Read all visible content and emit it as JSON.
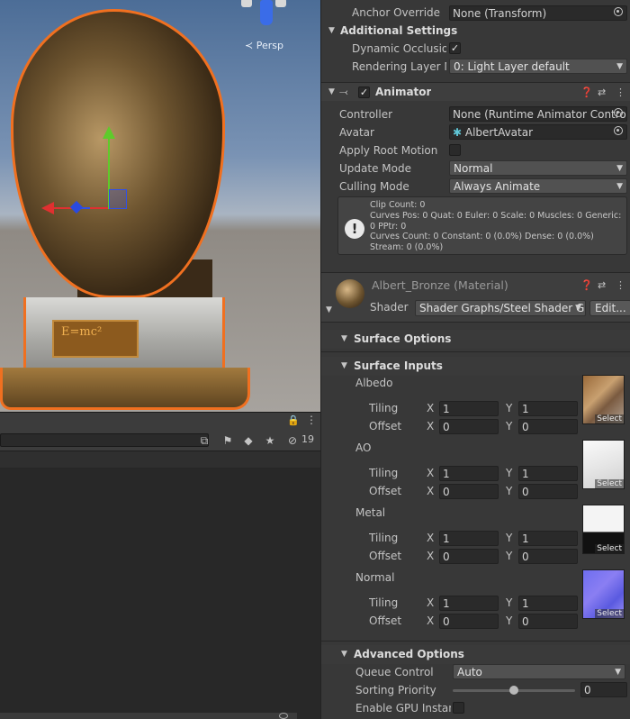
{
  "scene": {
    "camera_label": "Persp",
    "plaque_text": "E=mc²"
  },
  "hierarchy": {
    "visible_count": "19"
  },
  "inspector": {
    "renderer_tail": {
      "anchor_override_label": "Anchor Override",
      "anchor_override_value": "None (Transform)",
      "additional_settings_label": "Additional Settings",
      "dynamic_occlusion_label": "Dynamic Occlusion",
      "dynamic_occlusion_checked": true,
      "rendering_layer_label": "Rendering Layer M",
      "rendering_layer_value": "0: Light Layer default"
    },
    "animator": {
      "title": "Animator",
      "enabled": true,
      "controller_label": "Controller",
      "controller_value": "None (Runtime Animator Contro",
      "avatar_label": "Avatar",
      "avatar_value": "AlbertAvatar",
      "apply_root_motion_label": "Apply Root Motion",
      "apply_root_motion_checked": false,
      "update_mode_label": "Update Mode",
      "update_mode_value": "Normal",
      "culling_mode_label": "Culling Mode",
      "culling_mode_value": "Always Animate",
      "info_lines": [
        "Clip Count: 0",
        "Curves Pos: 0 Quat: 0 Euler: 0 Scale: 0 Muscles: 0 Generic:",
        "0 PPtr: 0",
        "Curves Count: 0 Constant: 0 (0.0%) Dense: 0 (0.0%)",
        "Stream: 0 (0.0%)"
      ]
    },
    "material": {
      "title": "Albert_Bronze (Material)",
      "shader_label": "Shader",
      "shader_value": "Shader Graphs/Steel Shader G",
      "edit_button": "Edit...",
      "surface_options_label": "Surface Options",
      "surface_inputs_label": "Surface Inputs",
      "tiling_label": "Tiling",
      "offset_label": "Offset",
      "x_label": "X",
      "y_label": "Y",
      "select_label": "Select",
      "textures": [
        {
          "name": "Albedo",
          "tiling_x": "1",
          "tiling_y": "1",
          "offset_x": "0",
          "offset_y": "0"
        },
        {
          "name": "AO",
          "tiling_x": "1",
          "tiling_y": "1",
          "offset_x": "0",
          "offset_y": "0"
        },
        {
          "name": "Metal",
          "tiling_x": "1",
          "tiling_y": "1",
          "offset_x": "0",
          "offset_y": "0"
        },
        {
          "name": "Normal",
          "tiling_x": "1",
          "tiling_y": "1",
          "offset_x": "0",
          "offset_y": "0"
        }
      ],
      "advanced_options_label": "Advanced Options",
      "queue_control_label": "Queue Control",
      "queue_control_value": "Auto",
      "sorting_priority_label": "Sorting Priority",
      "sorting_priority_value": "0",
      "sorting_priority_slider_fraction": 0.5,
      "gpu_instancing_label": "Enable GPU Instanc",
      "gpu_instancing_checked": false
    }
  },
  "colors": {
    "selection_outline": "#f07020",
    "gizmo_x": "#e03030",
    "gizmo_y": "#5ecb2a",
    "gizmo_z": "#3050e8",
    "panel_bg": "#383838"
  }
}
